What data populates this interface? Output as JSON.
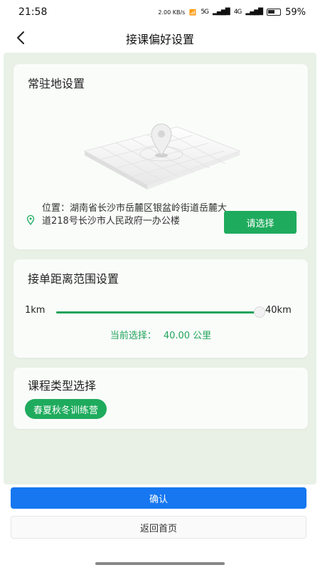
{
  "status_bar": {
    "time": "21:58",
    "net_speed": "2.00 KB/s",
    "signal_1": "5G",
    "signal_2": "4G",
    "battery": "59%"
  },
  "header": {
    "title": "接课偏好设置"
  },
  "location_card": {
    "title": "常驻地设置",
    "location_text": "位置：湖南省长沙市岳麓区银盆岭街道岳麓大道218号长沙市人民政府一办公楼",
    "select_label": "请选择"
  },
  "distance_card": {
    "title": "接单距离范围设置",
    "min_label": "1km",
    "max_label": "40km",
    "current_prefix": "当前选择：",
    "current_value": "40.00 公里",
    "slider_fraction": 1.0
  },
  "course_card": {
    "title": "课程类型选择",
    "tags": [
      "春夏秋冬训练营"
    ]
  },
  "actions": {
    "confirm_label": "确认",
    "home_label": "返回首页"
  },
  "colors": {
    "accent_green": "#1fab5d",
    "confirm_blue": "#1677f0",
    "page_bg": "#e9f1e6"
  }
}
